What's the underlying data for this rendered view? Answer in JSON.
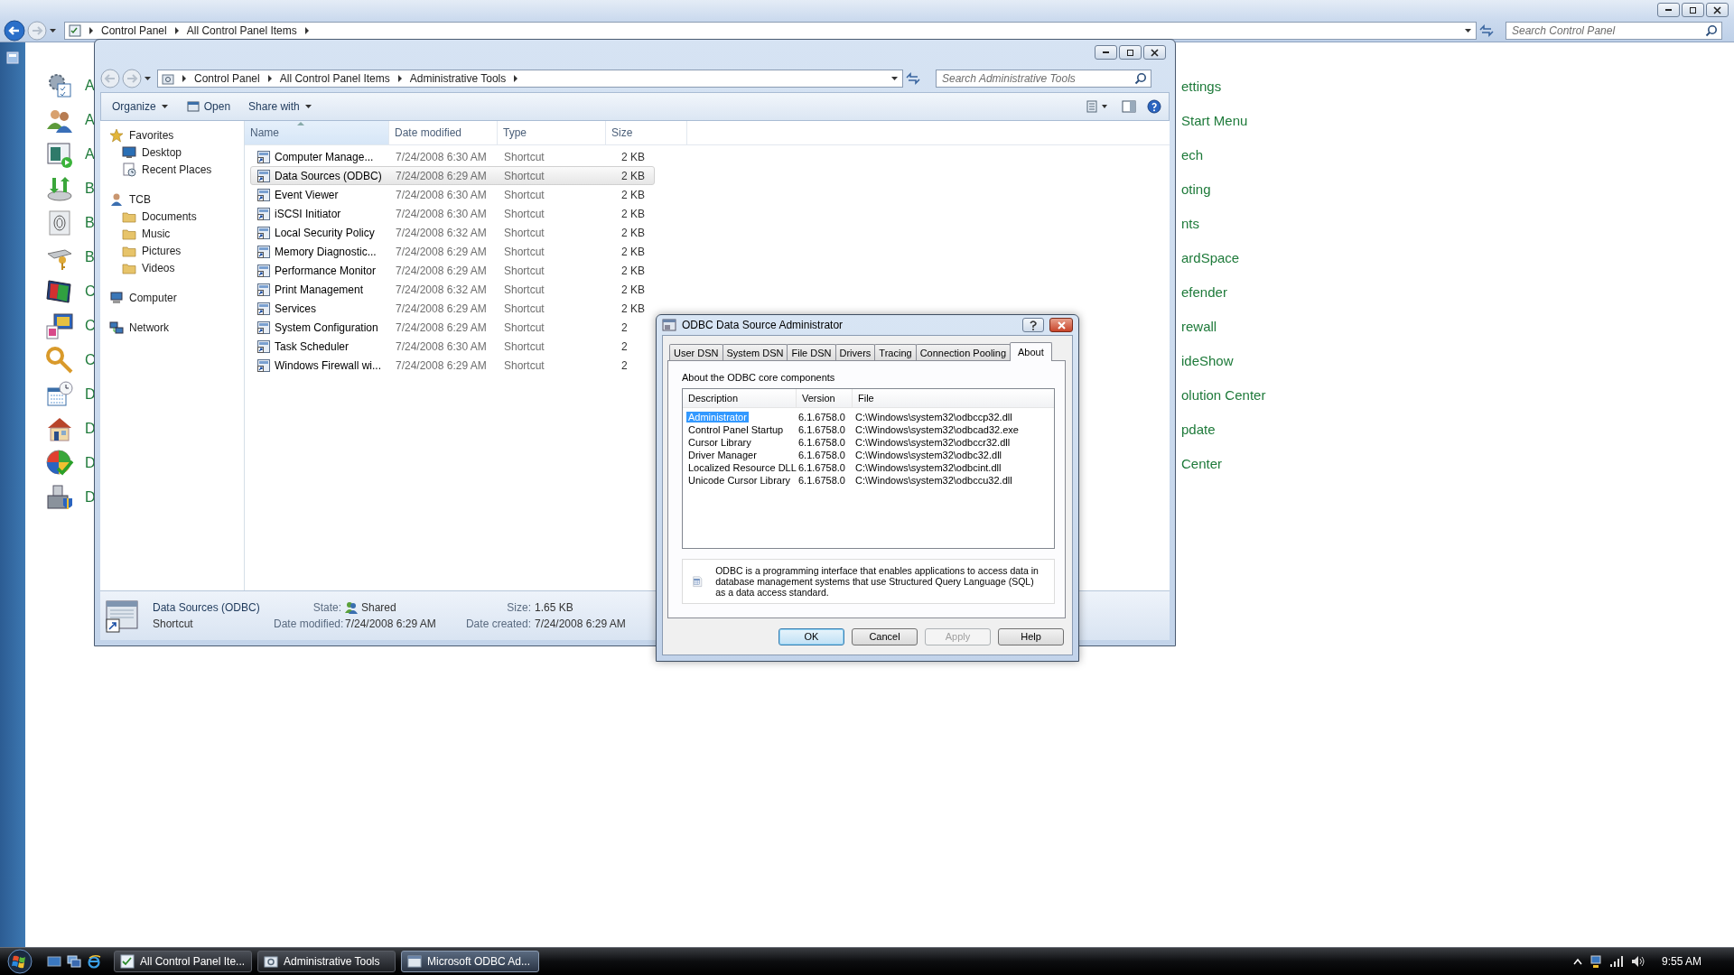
{
  "control_panel": {
    "address": [
      "Control Panel",
      "All Control Panel Items"
    ],
    "search": {
      "placeholder": "Search Control Panel"
    },
    "left_items": [
      "A",
      "A",
      "A",
      "B",
      "B",
      "B",
      "C",
      "C",
      "C",
      "D",
      "D",
      "D",
      "D"
    ],
    "right_items": [
      "ettings",
      "Start Menu",
      "ech",
      "oting",
      "nts",
      "ardSpace",
      "efender",
      "rewall",
      "ideShow",
      "olution Center",
      "pdate",
      "Center"
    ]
  },
  "explorer": {
    "address": [
      "Control Panel",
      "All Control Panel Items",
      "Administrative Tools"
    ],
    "search": {
      "placeholder": "Search Administrative Tools"
    },
    "toolbar": [
      {
        "label": "Organize",
        "kind": "menu"
      },
      {
        "label": "Open",
        "kind": "open"
      },
      {
        "label": "Share with",
        "kind": "menu"
      }
    ],
    "nav": [
      {
        "label": "Favorites",
        "kind": "star",
        "children": [
          {
            "label": "Desktop",
            "kind": "desktop"
          },
          {
            "label": "Recent Places",
            "kind": "recent"
          }
        ]
      },
      {
        "label": "TCB",
        "kind": "user",
        "children": [
          {
            "label": "Documents",
            "kind": "folder"
          },
          {
            "label": "Music",
            "kind": "folder"
          },
          {
            "label": "Pictures",
            "kind": "folder"
          },
          {
            "label": "Videos",
            "kind": "folder"
          }
        ]
      },
      {
        "label": "Computer",
        "kind": "computer"
      },
      {
        "label": "Network",
        "kind": "network"
      }
    ],
    "columns": [
      "Name",
      "Date modified",
      "Type",
      "Size"
    ],
    "rows": [
      {
        "name": "Computer Manage...",
        "date": "7/24/2008 6:30 AM",
        "type": "Shortcut",
        "size": "2 KB",
        "selected": false
      },
      {
        "name": "Data Sources (ODBC)",
        "date": "7/24/2008 6:29 AM",
        "type": "Shortcut",
        "size": "2 KB",
        "selected": true
      },
      {
        "name": "Event Viewer",
        "date": "7/24/2008 6:30 AM",
        "type": "Shortcut",
        "size": "2 KB",
        "selected": false
      },
      {
        "name": "iSCSI Initiator",
        "date": "7/24/2008 6:30 AM",
        "type": "Shortcut",
        "size": "2 KB",
        "selected": false
      },
      {
        "name": "Local Security Policy",
        "date": "7/24/2008 6:32 AM",
        "type": "Shortcut",
        "size": "2 KB",
        "selected": false
      },
      {
        "name": "Memory Diagnostic...",
        "date": "7/24/2008 6:29 AM",
        "type": "Shortcut",
        "size": "2 KB",
        "selected": false
      },
      {
        "name": "Performance Monitor",
        "date": "7/24/2008 6:29 AM",
        "type": "Shortcut",
        "size": "2 KB",
        "selected": false
      },
      {
        "name": "Print Management",
        "date": "7/24/2008 6:32 AM",
        "type": "Shortcut",
        "size": "2 KB",
        "selected": false
      },
      {
        "name": "Services",
        "date": "7/24/2008 6:29 AM",
        "type": "Shortcut",
        "size": "2 KB",
        "selected": false
      },
      {
        "name": "System Configuration",
        "date": "7/24/2008 6:29 AM",
        "type": "Shortcut",
        "size": "2",
        "selected": false
      },
      {
        "name": "Task Scheduler",
        "date": "7/24/2008 6:30 AM",
        "type": "Shortcut",
        "size": "2",
        "selected": false
      },
      {
        "name": "Windows Firewall wi...",
        "date": "7/24/2008 6:29 AM",
        "type": "Shortcut",
        "size": "2",
        "selected": false
      }
    ],
    "details": {
      "name": "Data Sources (ODBC)",
      "type": "Shortcut",
      "fields": [
        {
          "label": "State:",
          "value": "Shared",
          "kind": "shared"
        },
        {
          "label": "Size:",
          "value": "1.65 KB",
          "kind": "plain"
        },
        {
          "label": "Date modified:",
          "value": "7/24/2008 6:29 AM",
          "kind": "plain"
        },
        {
          "label": "Date created:",
          "value": "7/24/2008 6:29 AM",
          "kind": "plain"
        }
      ]
    }
  },
  "dialog": {
    "title": "ODBC Data Source Administrator",
    "tabs": [
      {
        "label": "User DSN",
        "selected": false
      },
      {
        "label": "System DSN",
        "selected": false
      },
      {
        "label": "File DSN",
        "selected": false
      },
      {
        "label": "Drivers",
        "selected": false
      },
      {
        "label": "Tracing",
        "selected": false
      },
      {
        "label": "Connection Pooling",
        "selected": false
      },
      {
        "label": "About",
        "selected": true
      }
    ],
    "heading": "About the ODBC core components",
    "columns": [
      "Description",
      "Version",
      "File"
    ],
    "rows": [
      {
        "description": "Administrator",
        "version": "6.1.6758.0",
        "file": "C:\\Windows\\system32\\odbccp32.dll",
        "selected": true
      },
      {
        "description": "Control Panel Startup",
        "version": "6.1.6758.0",
        "file": "C:\\Windows\\system32\\odbcad32.exe",
        "selected": false
      },
      {
        "description": "Cursor Library",
        "version": "6.1.6758.0",
        "file": "C:\\Windows\\system32\\odbccr32.dll",
        "selected": false
      },
      {
        "description": "Driver Manager",
        "version": "6.1.6758.0",
        "file": "C:\\Windows\\system32\\odbc32.dll",
        "selected": false
      },
      {
        "description": "Localized Resource DLL",
        "version": "6.1.6758.0",
        "file": "C:\\Windows\\system32\\odbcint.dll",
        "selected": false
      },
      {
        "description": "Unicode Cursor Library",
        "version": "6.1.6758.0",
        "file": "C:\\Windows\\system32\\odbccu32.dll",
        "selected": false
      }
    ],
    "info": "ODBC is a programming interface that enables applications to access data in database management systems that use Structured Query Language (SQL) as a data access standard.",
    "buttons": [
      {
        "label": "OK",
        "default": true,
        "disabled": false
      },
      {
        "label": "Cancel",
        "default": false,
        "disabled": false
      },
      {
        "label": "Apply",
        "default": false,
        "disabled": true
      },
      {
        "label": "Help",
        "default": false,
        "disabled": false
      }
    ]
  },
  "taskbar": {
    "tasks": [
      {
        "label": "All Control Panel Ite...",
        "selected": false
      },
      {
        "label": "Administrative Tools",
        "selected": false
      },
      {
        "label": "Microsoft ODBC Ad...",
        "selected": true
      }
    ],
    "clock": "9:55 AM"
  }
}
